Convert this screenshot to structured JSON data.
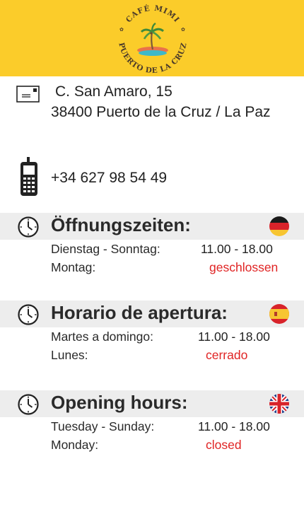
{
  "header": {
    "logo": {
      "top_text": "CAFÉ MIMI",
      "bottom_text": "PUERTO DE LA CRUZ",
      "icon": "palm-tree-beach-icon"
    },
    "background": "#fbcc2a"
  },
  "contact": {
    "address_icon": "envelope-icon",
    "address_line1": "C. San Amaro, 15",
    "address_line2": "38400 Puerto de la Cruz / La Paz",
    "phone_icon": "mobile-phone-icon",
    "phone": "+34 627 98 54 49"
  },
  "hours": {
    "german": {
      "flag": "germany-flag-icon",
      "title": "Öffnungszeiten:",
      "days_open": "Dienstag - Sonntag:",
      "time_open": "11.00 - 18.00",
      "days_closed": "Montag:",
      "closed_label": "geschlossen"
    },
    "spanish": {
      "flag": "spain-flag-icon",
      "title": "Horario de apertura:",
      "days_open": "Martes a domingo:",
      "time_open": "11.00 - 18.00",
      "days_closed": "Lunes:",
      "closed_label": "cerrado"
    },
    "english": {
      "flag": "uk-flag-icon",
      "title": "Opening hours:",
      "days_open": "Tuesday - Sunday:",
      "time_open": "11.00 - 18.00",
      "days_closed": "Monday:",
      "closed_label": "closed"
    }
  },
  "colors": {
    "accent_yellow": "#fbcc2a",
    "closed_red": "#e02424",
    "section_band": "#ededed"
  }
}
